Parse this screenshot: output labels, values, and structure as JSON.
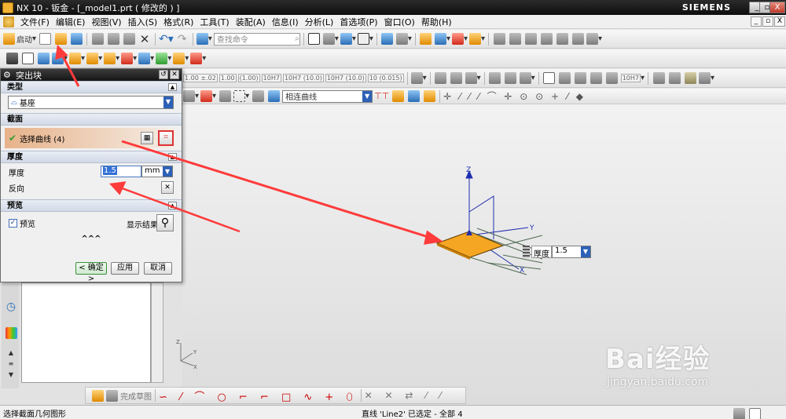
{
  "window": {
    "title": "NX 10 - 钣金 - [_model1.prt  ( 修改的 ) ]",
    "brand": "SIEMENS",
    "controls": [
      "_",
      "▫",
      "X"
    ],
    "sub_controls": [
      "_",
      "▫",
      "X"
    ]
  },
  "menu": [
    "文件(F)",
    "编辑(E)",
    "视图(V)",
    "插入(S)",
    "格式(R)",
    "工具(T)",
    "装配(A)",
    "信息(I)",
    "分析(L)",
    "首选项(P)",
    "窗口(O)",
    "帮助(H)"
  ],
  "toolbar1": {
    "start_label": "启动",
    "search_placeholder": "查找命令"
  },
  "toolbar3": {
    "dims": [
      "1.00\n±.02",
      "1.00",
      "(1.00)",
      "10H7",
      "10H7\n(10.0)",
      "10H7\n(10.0)",
      "10\n(0.015)"
    ],
    "dim_right": "10H7"
  },
  "toolbar4": {
    "curve_rule": "相连曲线"
  },
  "dialog": {
    "title": "突出块",
    "sections": {
      "type": "类型",
      "section": "截面",
      "thickness": "厚度",
      "preview": "预览"
    },
    "type_value": "基座",
    "select_curve": "选择曲线 (4)",
    "thickness_label": "厚度",
    "thickness_value": "1.5",
    "unit": "mm",
    "reverse_label": "反向",
    "preview_label": "预览",
    "preview_checked": true,
    "show_result": "显示结果",
    "more": "^^^",
    "ok": "< 确定 >",
    "apply": "应用",
    "cancel": "取消"
  },
  "scene": {
    "axis_z": "Z",
    "axis_y": "Y",
    "axis_x": "X",
    "float_label": "厚度",
    "float_value": "1.5",
    "mini_z": "Z",
    "mini_y": "Y",
    "mini_x": "X"
  },
  "sketchbar": {
    "finish": "完成草图"
  },
  "status": {
    "left": "选择截面几何图形",
    "center": "直线 'Line2' 已选定 - 全部 4"
  },
  "watermark": {
    "main": "Bai经验",
    "sub": "jingyan.baidu.com"
  },
  "colors": {
    "highlight_orange": "#f5a623",
    "annotation_red": "#ff3b3b",
    "wcs_blue": "#1f2fb0"
  }
}
